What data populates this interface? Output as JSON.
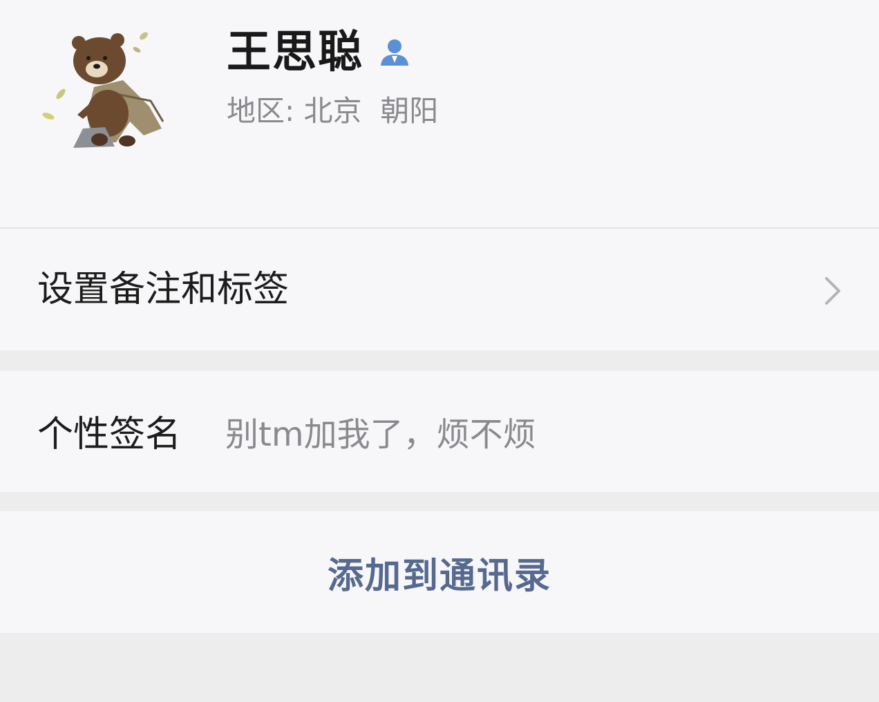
{
  "profile": {
    "name": "王思聪",
    "region_label": "地区:",
    "region_city": "北京",
    "region_district": "朝阳",
    "avatar_icon": "brown-bear-sticker-avatar",
    "contact_icon": "person-icon",
    "contact_icon_color": "#5b8fd6"
  },
  "remark_row": {
    "label": "设置备注和标签",
    "chevron_icon": "chevron-right-icon"
  },
  "signature_row": {
    "label": "个性签名",
    "value": "别tm加我了，烦不烦"
  },
  "actions": {
    "add_to_contacts": "添加到通讯录"
  },
  "colors": {
    "background": "#ededee",
    "card": "#f7f7f9",
    "link": "#56698f",
    "secondary_text": "#8a8a8e"
  }
}
